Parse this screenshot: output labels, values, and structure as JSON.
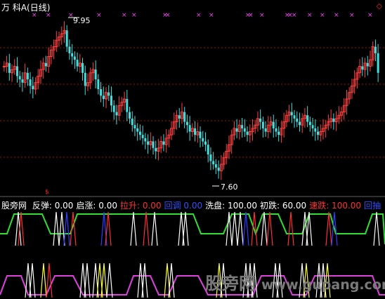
{
  "chart_title": "万  科A(日线)",
  "price_high_label": "9.95",
  "price_low_label": "7.60",
  "indicator": {
    "name": "股旁网",
    "items": [
      {
        "label": "反弹:",
        "value": "0.00",
        "color": "#ffffff"
      },
      {
        "label": "启涨:",
        "value": "0.00",
        "color": "#ffffff"
      },
      {
        "label": "拉升:",
        "value": "0.00",
        "color": "#ff3030"
      },
      {
        "label": "回调",
        "value": "0.00",
        "color": "#3050ff"
      },
      {
        "label": "洗盘:",
        "value": "100.00",
        "color": "#ffffff"
      },
      {
        "label": "初跌:",
        "value": "60.00",
        "color": "#ffffff"
      },
      {
        "label": "速跌:",
        "value": "100.00",
        "color": "#ff3030"
      },
      {
        "label": "回抽",
        "value": "",
        "color": "#3050ff"
      }
    ]
  },
  "watermark": {
    "cn": "股旁网",
    "url": "www.gupang.com"
  },
  "colors": {
    "up": "#ff4040",
    "down": "#40e0e0",
    "grid": "#a01010",
    "marker": "#ff40ff",
    "green_line": "#30e030",
    "magenta_line": "#e040e0",
    "yellow": "#ffff40",
    "blue": "#3040ff",
    "red": "#ff2020"
  },
  "chart_data": {
    "type": "candlestick",
    "y_range": [
      7.5,
      10.1
    ],
    "high": 9.95,
    "low": 7.6,
    "closes": [
      9.3,
      9.35,
      9.2,
      9.25,
      9.3,
      9.15,
      9.1,
      9.05,
      9.2,
      9.1,
      9.0,
      8.95,
      9.05,
      9.15,
      9.25,
      9.35,
      9.3,
      9.45,
      9.55,
      9.6,
      9.7,
      9.75,
      9.8,
      9.85,
      9.6,
      9.5,
      9.45,
      9.4,
      9.3,
      9.35,
      9.2,
      9.0,
      9.05,
      9.2,
      9.25,
      9.1,
      8.95,
      8.85,
      8.8,
      8.9,
      8.85,
      8.7,
      8.6,
      8.55,
      8.7,
      8.75,
      8.8,
      8.6,
      8.5,
      8.4,
      8.35,
      8.3,
      8.25,
      8.2,
      8.15,
      8.1,
      8.15,
      8.05,
      8.0,
      8.05,
      8.15,
      8.1,
      8.2,
      8.25,
      8.35,
      8.45,
      8.55,
      8.5,
      8.6,
      8.45,
      8.4,
      8.3,
      8.35,
      8.25,
      8.3,
      8.2,
      8.15,
      8.1,
      7.95,
      7.85,
      7.8,
      7.75,
      7.7,
      7.8,
      7.9,
      8.0,
      8.1,
      8.25,
      8.35,
      8.3,
      8.4,
      8.35,
      8.3,
      8.25,
      8.3,
      8.35,
      8.4,
      8.5,
      8.45,
      8.35,
      8.3,
      8.4,
      8.45,
      8.35,
      8.3,
      8.25,
      8.35,
      8.45,
      8.55,
      8.6,
      8.55,
      8.5,
      8.45,
      8.4,
      8.5,
      8.55,
      8.45,
      8.4,
      8.35,
      8.3,
      8.25,
      8.3,
      8.35,
      8.4,
      8.45,
      8.5,
      8.45,
      8.5,
      8.55,
      8.6,
      8.7,
      8.8,
      8.9,
      9.0,
      9.1,
      9.2,
      9.3,
      9.25,
      9.35,
      9.3,
      9.4,
      9.6,
      9.5,
      9.2
    ]
  }
}
